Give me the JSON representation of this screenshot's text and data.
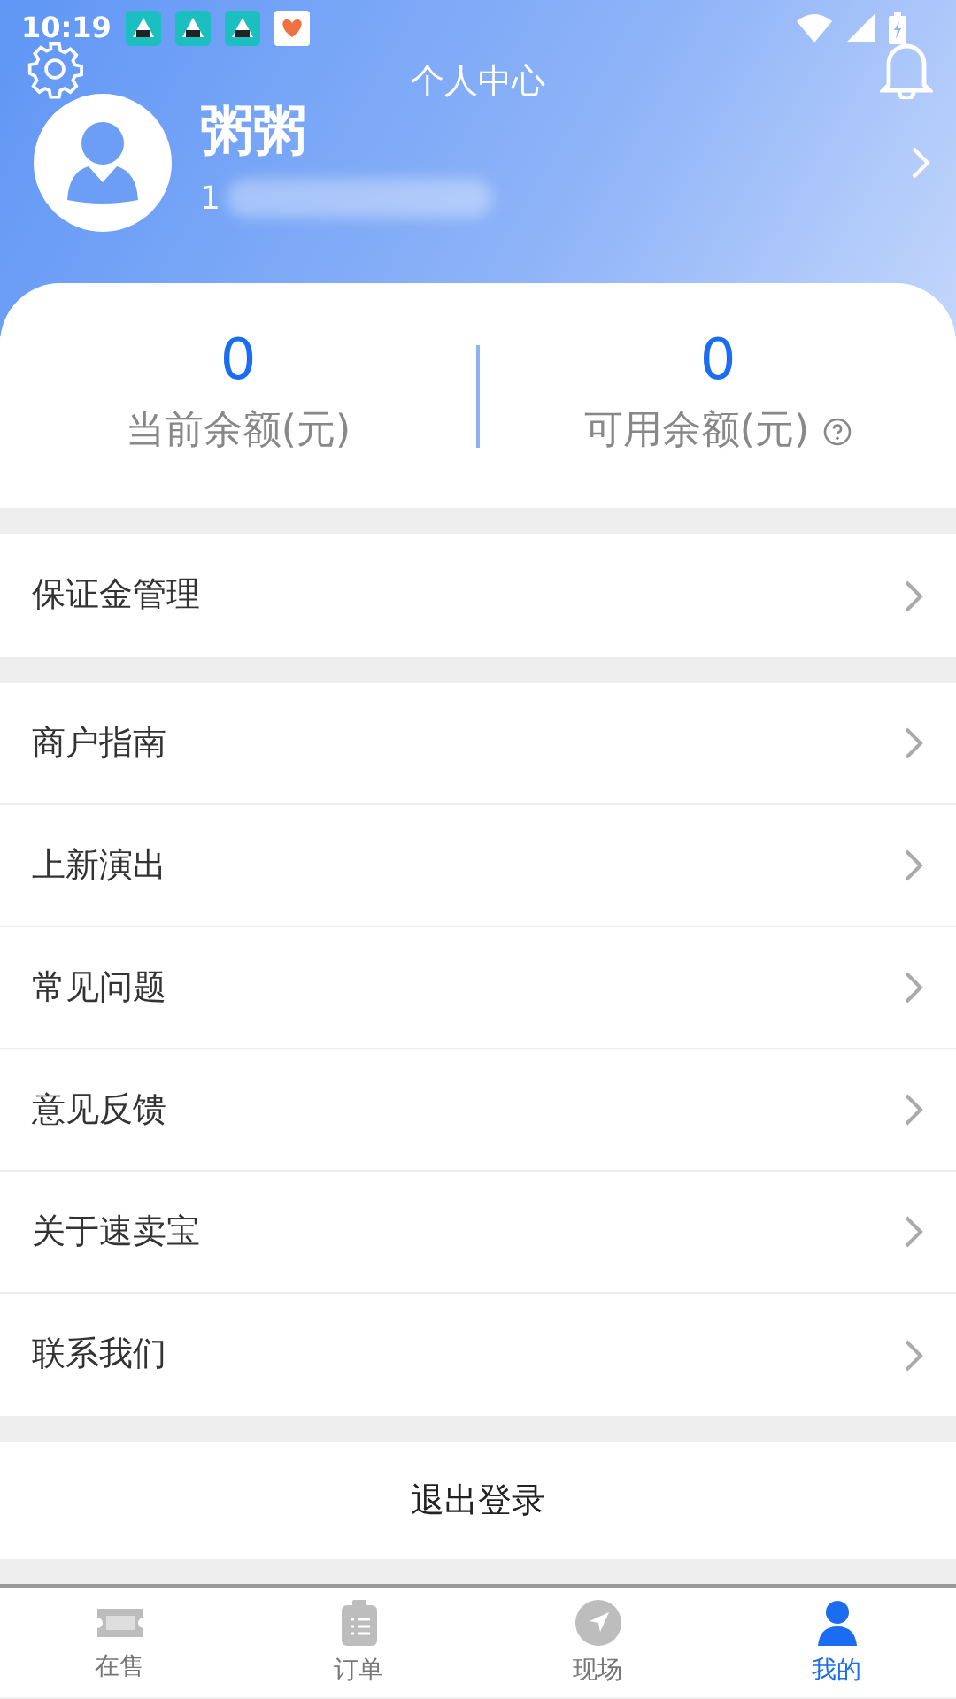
{
  "status_bar": {
    "time": "10:19"
  },
  "header": {
    "title": "个人中心",
    "name": "粥粥",
    "phone": "1"
  },
  "balances": [
    {
      "value": "0",
      "label": "当前余额(元)",
      "kind": "plain"
    },
    {
      "value": "0",
      "label": "可用余额(元)",
      "kind": "help"
    }
  ],
  "menu_groups": [
    [
      {
        "label": "保证金管理"
      }
    ],
    [
      {
        "label": "商户指南"
      },
      {
        "label": "上新演出"
      },
      {
        "label": "常见问题"
      },
      {
        "label": "意见反馈"
      },
      {
        "label": "关于速卖宝"
      },
      {
        "label": "联系我们"
      }
    ]
  ],
  "logout": "退出登录",
  "tabs": [
    {
      "label": "在售",
      "kind": "ticket",
      "selected": false
    },
    {
      "label": "订单",
      "kind": "clipboard",
      "selected": false
    },
    {
      "label": "现场",
      "kind": "navigate",
      "selected": false
    },
    {
      "label": "我的",
      "kind": "person",
      "selected": true
    }
  ]
}
